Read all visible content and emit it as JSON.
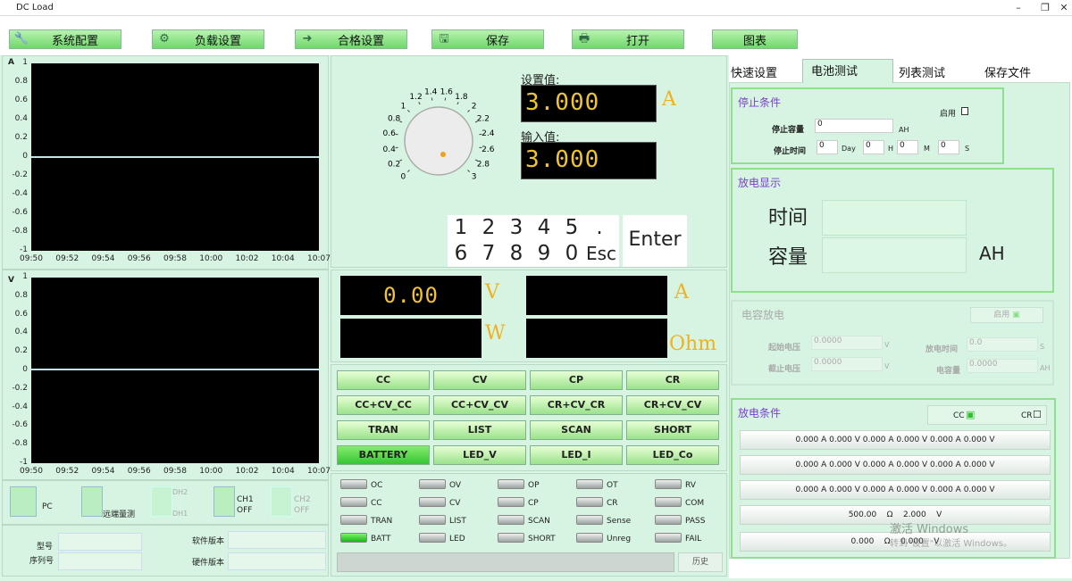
{
  "window": {
    "title": "DC Load",
    "min": "–",
    "restore": "❐",
    "close": "✕"
  },
  "toolbar": {
    "items": [
      {
        "label": "系统配置",
        "icon": "wrench-icon"
      },
      {
        "label": "负载设置",
        "icon": "gear-icon"
      },
      {
        "label": "合格设置",
        "icon": "arrow-icon"
      },
      {
        "label": "保存",
        "icon": "save-icon"
      },
      {
        "label": "打开",
        "icon": "open-icon"
      },
      {
        "label": "图表",
        "icon": ""
      }
    ]
  },
  "chart_data": [
    {
      "type": "line",
      "ylabel": "A",
      "y_ticks": [
        "1",
        "0.8",
        "0.6",
        "0.4",
        "0.2",
        "0",
        "-0.2",
        "-0.4",
        "-0.6",
        "-0.8",
        "-1"
      ],
      "x_ticks": [
        "09:50",
        "09:52",
        "09:54",
        "09:56",
        "09:58",
        "10:00",
        "10:02",
        "10:04",
        "10:07"
      ],
      "ylim": [
        -1,
        1
      ],
      "series": [
        {
          "values": [
            0,
            0,
            0,
            0,
            0,
            0,
            0,
            0,
            0
          ]
        }
      ]
    },
    {
      "type": "line",
      "ylabel": "V",
      "y_ticks": [
        "1",
        "0.8",
        "0.6",
        "0.4",
        "0.2",
        "0",
        "-0.2",
        "-0.4",
        "-0.6",
        "-0.8",
        "-1"
      ],
      "x_ticks": [
        "09:50",
        "09:52",
        "09:54",
        "09:56",
        "09:58",
        "10:00",
        "10:02",
        "10:04",
        "10:07"
      ],
      "ylim": [
        -1,
        1
      ],
      "series": [
        {
          "values": [
            0,
            0,
            0,
            0,
            0,
            0,
            0,
            0,
            0
          ]
        }
      ]
    }
  ],
  "knob": {
    "ticks": [
      "0",
      "0.2",
      "0.4",
      "0.6",
      "0.8",
      "1",
      "1.2",
      "1.4",
      "1.6",
      "1.8",
      "2",
      "2.2",
      "2.4",
      "2.6",
      "2.8",
      "3"
    ]
  },
  "setpoint": {
    "label": "设置值:",
    "value": "3.000",
    "unit": "A"
  },
  "input": {
    "label": "输入值:",
    "value": "3.000"
  },
  "keypad": {
    "row1": [
      "1",
      "2",
      "3",
      "4",
      "5",
      "."
    ],
    "row2": [
      "6",
      "7",
      "8",
      "9",
      "0",
      "Esc"
    ],
    "enter": "Enter"
  },
  "readings": {
    "v": "0.00",
    "v_unit": "V",
    "a": "",
    "a_unit": "A",
    "w": "",
    "w_unit": "W",
    "ohm": "",
    "ohm_unit": "Ohm"
  },
  "modes": [
    [
      "CC",
      "CV",
      "CP",
      "CR"
    ],
    [
      "CC+CV_CC",
      "CC+CV_CV",
      "CR+CV_CR",
      "CR+CV_CV"
    ],
    [
      "TRAN",
      "LIST",
      "SCAN",
      "SHORT"
    ],
    [
      "BATTERY",
      "LED_V",
      "LED_I",
      "LED_Co"
    ]
  ],
  "status": {
    "pc": "PC",
    "remote": "远端量测",
    "dh2": "DH2",
    "dh1": "DH1",
    "ch1": "CH1",
    "ch1s": "OFF",
    "ch2": "CH2",
    "ch2s": "OFF"
  },
  "info": {
    "model": "型号",
    "serial": "序列号",
    "sw": "软件版本",
    "hw": "硬件版本"
  },
  "leds": [
    [
      "OC",
      "OV",
      "OP",
      "OT",
      "RV"
    ],
    [
      "CC",
      "CV",
      "CP",
      "CR",
      "COM"
    ],
    [
      "TRAN",
      "LIST",
      "SCAN",
      "Sense",
      "PASS"
    ],
    [
      "BATT",
      "LED",
      "SHORT",
      "Unreg",
      "FAIL"
    ]
  ],
  "history": "历史",
  "tabs": [
    "快速设置",
    "电池测试",
    "列表测试",
    "保存文件"
  ],
  "stop": {
    "title": "停止条件",
    "enable": "启用",
    "cap_label": "停止容量",
    "cap_value": "0",
    "cap_unit": "AH",
    "time_label": "停止时间",
    "d": "0",
    "d_unit": "Day",
    "h": "0",
    "h_unit": "H",
    "m": "0",
    "m_unit": "M",
    "s": "0",
    "s_unit": "S"
  },
  "display": {
    "title": "放电显示",
    "time": "时间",
    "cap": "容量",
    "unit": "AH"
  },
  "capd": {
    "title": "电容放电",
    "enable": "启用",
    "sv": "起始电压",
    "sv_val": "0.0000",
    "sv_unit": "V",
    "ev": "截止电压",
    "ev_val": "0.0000",
    "ev_unit": "V",
    "dt": "放电时间",
    "dt_val": "0.0",
    "dt_unit": "S",
    "cap": "电容量",
    "cap_val": "0.0000",
    "cap_unit": "AH"
  },
  "cond": {
    "title": "放电条件",
    "cc": "CC",
    "cr": "CR",
    "rows": [
      "0.000 A 0.000 V 0.000 A 0.000 V 0.000 A 0.000 V",
      "0.000 A 0.000 V 0.000 A 0.000 V 0.000 A 0.000 V",
      "0.000 A 0.000 V 0.000 A 0.000 V 0.000 A 0.000 V",
      "500.00    Ω    2.000    V",
      "0.000    Ω    0.000    V"
    ]
  },
  "watermark": {
    "l1": "激活 Windows",
    "l2": "转到\"设置\"以激活 Windows。"
  }
}
